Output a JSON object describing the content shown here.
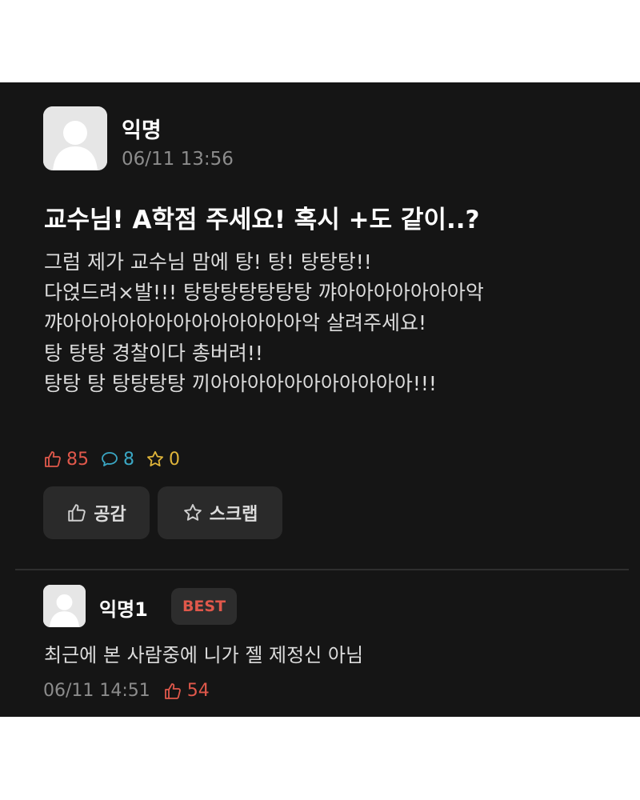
{
  "post": {
    "author": "익명",
    "timestamp": "06/11 13:56",
    "title": "교수님! A학점 주세요! 혹시 +도 같이..?",
    "body_lines": [
      "그럼 제가 교수님 맘에 탕! 탕! 탕탕탕!!",
      "다얹드려×발!!! 탕탕탕탕탕탕탕 꺄아아아아아아아악",
      "꺄아아아아아아아아아아아아아악 살려주세요!",
      "탕 탕탕 경찰이다 총버려!!",
      "탕탕 탕 탕탕탕탕 끼아아아아아아아아아아아!!!"
    ],
    "stats": {
      "likes": "85",
      "comments": "8",
      "scraps": "0"
    },
    "buttons": {
      "empathy": "공감",
      "scrap": "스크랩"
    }
  },
  "comment": {
    "author": "익명1",
    "badge": "BEST",
    "body": "최근에 본 사람중에 니가 젤 제정신 아님",
    "timestamp": "06/11 14:51",
    "likes": "54"
  },
  "icons": {
    "like": "thumbs-up-icon",
    "comment": "speech-bubble-icon",
    "scrap": "star-icon",
    "avatar": "default-user-avatar"
  },
  "colors": {
    "background": "#151515",
    "like": "#e0584b",
    "comment": "#3aa7c4",
    "scrap": "#e0b53a",
    "best": "#e0584b"
  }
}
